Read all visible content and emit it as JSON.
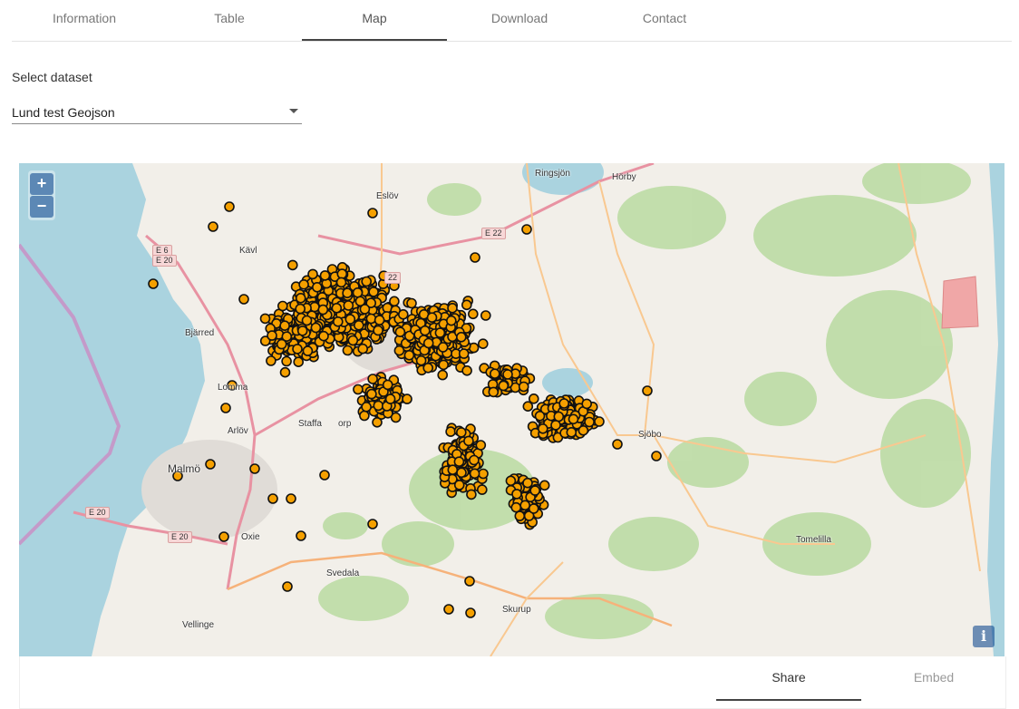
{
  "tabs": [
    {
      "label": "Information"
    },
    {
      "label": "Table"
    },
    {
      "label": "Map",
      "active": true
    },
    {
      "label": "Download"
    },
    {
      "label": "Contact"
    }
  ],
  "dataset": {
    "label": "Select dataset",
    "value": "Lund test Geojson"
  },
  "map": {
    "zoom_in": "+",
    "zoom_out": "−",
    "info": "i",
    "places": {
      "eslov": "Eslöv",
      "horby": "Hörby",
      "kavlinge": "Kävl",
      "bjarred": "Bjärred",
      "lomma": "Lomma",
      "arlov": "Arlöv",
      "staffanstorp_a": "Staffa",
      "staffanstorp_b": "orp",
      "malmo": "Malmö",
      "oxie": "Oxie",
      "svedala": "Svedala",
      "skurup": "Skurup",
      "vellinge": "Vellinge",
      "sjobo": "Sjöbo",
      "tomelilla": "Tomelilla",
      "ringsjon": "Ringsjön"
    },
    "roads": {
      "e6": "E 6",
      "e20a": "E 20",
      "e22": "E 22",
      "e20b": "E 20",
      "e20c": "E 20",
      "e22b": "22"
    },
    "colors": {
      "marker_fill": "#f5a000",
      "marker_stroke": "#111111",
      "water": "#aad3df",
      "forest": "#b8d8a0"
    }
  },
  "bottom_tabs": [
    {
      "label": "Share",
      "active": true
    },
    {
      "label": "Embed"
    }
  ]
}
